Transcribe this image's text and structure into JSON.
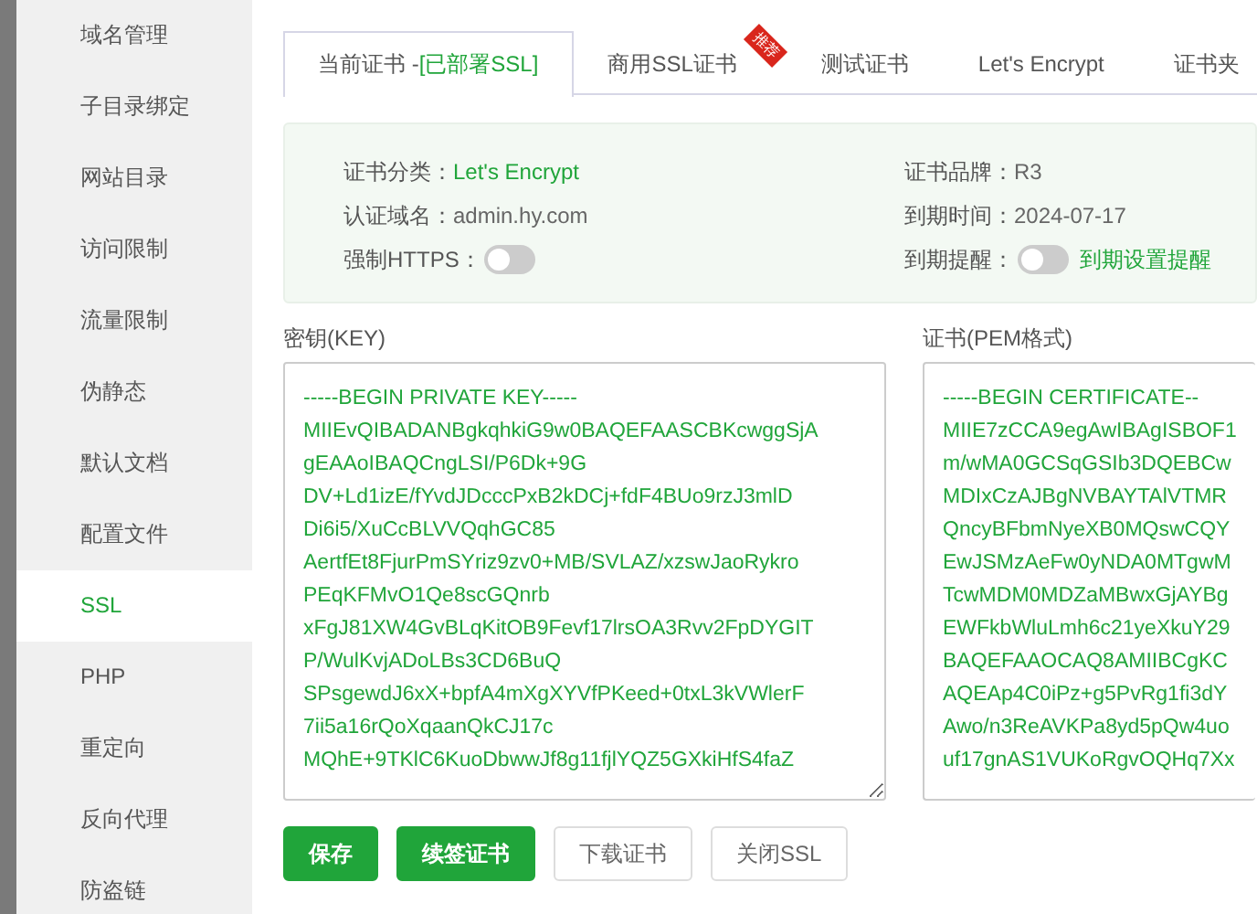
{
  "sidebar": {
    "items": [
      {
        "label": "域名管理",
        "selected": false
      },
      {
        "label": "子目录绑定",
        "selected": false
      },
      {
        "label": "网站目录",
        "selected": false
      },
      {
        "label": "访问限制",
        "selected": false
      },
      {
        "label": "流量限制",
        "selected": false
      },
      {
        "label": "伪静态",
        "selected": false
      },
      {
        "label": "默认文档",
        "selected": false
      },
      {
        "label": "配置文件",
        "selected": false
      },
      {
        "label": "SSL",
        "selected": true
      },
      {
        "label": "PHP",
        "selected": false
      },
      {
        "label": "重定向",
        "selected": false
      },
      {
        "label": "反向代理",
        "selected": false
      },
      {
        "label": "防盗链",
        "selected": false
      }
    ]
  },
  "tabs": [
    {
      "label": "当前证书 -",
      "status": "[已部署SSL]",
      "selected": true
    },
    {
      "label": "商用SSL证书",
      "badge": "推荐",
      "selected": false
    },
    {
      "label": "测试证书",
      "selected": false
    },
    {
      "label": "Let's Encrypt",
      "selected": false
    },
    {
      "label": "证书夹",
      "selected": false
    }
  ],
  "info": {
    "left": [
      {
        "kind": "text",
        "label": "证书分类：",
        "value": "Let's Encrypt",
        "highlight": true
      },
      {
        "kind": "text",
        "label": "认证域名：",
        "value": "admin.hy.com",
        "highlight": false
      },
      {
        "kind": "switch",
        "label": "强制HTTPS：",
        "on": false
      }
    ],
    "right": [
      {
        "kind": "text",
        "label": "证书品牌：",
        "value": "R3",
        "highlight": false
      },
      {
        "kind": "text",
        "label": "到期时间：",
        "value": "2024-07-17",
        "highlight": false
      },
      {
        "kind": "switch",
        "label": "到期提醒：",
        "on": false,
        "link": "到期设置提醒"
      }
    ]
  },
  "key": {
    "label": "密钥(KEY)",
    "lines": [
      "-----BEGIN PRIVATE KEY-----",
      "MIIEvQIBADANBgkqhkiG9w0BAQEFAASCBKcwggSjA",
      "gEAAoIBAQCngLSI/P6Dk+9G",
      "DV+Ld1izE/fYvdJDcccPxB2kDCj+fdF4BUo9rzJ3mlD",
      "Di6i5/XuCcBLVVQqhGC85",
      "AertfEt8FjurPmSYriz9zv0+MB/SVLAZ/xzswJaoRykro",
      "PEqKFMvO1Qe8scGQnrb",
      "xFgJ81XW4GvBLqKitOB9Fevf17lrsOA3Rvv2FpDYGIT",
      "P/WulKvjADoLBs3CD6BuQ",
      "SPsgewdJ6xX+bpfA4mXgXYVfPKeed+0txL3kVWlerF",
      "7ii5a16rQoXqaanQkCJ17c",
      "MQhE+9TKlC6KuoDbwwJf8g11fjlYQZ5GXkiHfS4faZ"
    ]
  },
  "certificate": {
    "label": "证书(PEM格式)",
    "lines": [
      "-----BEGIN CERTIFICATE--",
      "MIIE7zCCA9egAwIBAgISBOF1",
      "m/wMA0GCSqGSIb3DQEBCw",
      "MDIxCzAJBgNVBAYTAlVTMR",
      "QncyBFbmNyeXB0MQswCQY",
      "EwJSMzAeFw0yNDA0MTgwM",
      "TcwMDM0MDZaMBwxGjAYBg",
      "EWFkbWluLmh6c21yeXkuY29",
      "BAQEFAAOCAQ8AMIIBCgKC",
      "AQEAp4C0iPz+g5PvRg1fi3dY",
      "Awo/n3ReAVKPa8yd5pQw4uo",
      "uf17gnAS1VUKoRgvOQHq7Xx"
    ]
  },
  "buttons": [
    {
      "label": "保存",
      "kind": "primary"
    },
    {
      "label": "续签证书",
      "kind": "primary"
    },
    {
      "label": "下载证书",
      "kind": "outline"
    },
    {
      "label": "关闭SSL",
      "kind": "outline"
    }
  ]
}
